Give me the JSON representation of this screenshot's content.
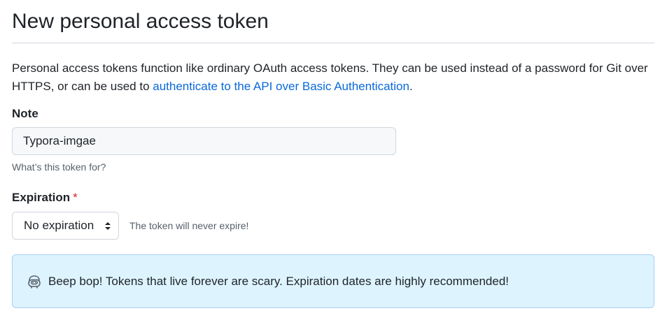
{
  "page_title": "New personal access token",
  "intro": {
    "text_before": "Personal access tokens function like ordinary OAuth access tokens. They can be used instead of a password for Git over HTTPS, or can be used to ",
    "link_text": "authenticate to the API over Basic Authentication",
    "text_after": "."
  },
  "note": {
    "label": "Note",
    "value": "Typora-imgae",
    "hint": "What’s this token for?"
  },
  "expiration": {
    "label": "Expiration",
    "required_marker": "*",
    "selected": "No expiration",
    "note": "The token will never expire!"
  },
  "flash": {
    "icon": "copilot-bot-icon",
    "message": "Beep bop! Tokens that live forever are scary. Expiration dates are highly recommended!"
  },
  "colors": {
    "link": "#0969da",
    "required": "#cf222e",
    "flash_bg": "#ddf4ff",
    "flash_border": "#a6cff5",
    "border": "#d0d7de"
  }
}
